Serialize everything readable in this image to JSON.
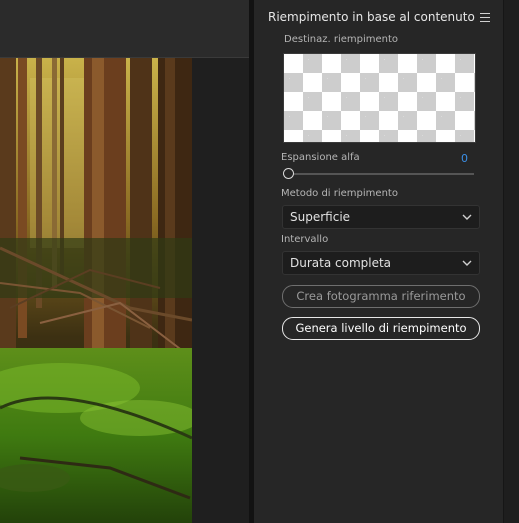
{
  "panel": {
    "title": "Riempimento in base al contenuto",
    "fill_target_label": "Destinaz. riempimento",
    "alpha_expansion_label": "Espansione alfa",
    "alpha_expansion_value": "0",
    "fill_method_label": "Metodo di riempimento",
    "fill_method_value": "Superficie",
    "range_label": "Intervallo",
    "range_value": "Durata completa",
    "create_reference_button": "Crea fotogramma riferimento",
    "generate_fill_button": "Genera livello di riempimento"
  },
  "icons": {
    "panel_menu": "hamburger-menu-icon",
    "dropdown_chevron": "chevron-down-icon"
  },
  "colors": {
    "accent_value": "#3b8fe6",
    "panel_bg": "#262626"
  }
}
